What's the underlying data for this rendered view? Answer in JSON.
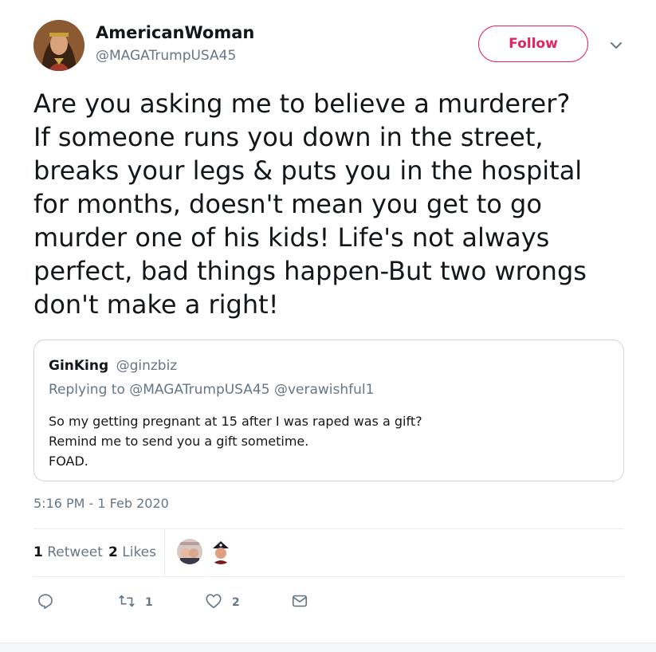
{
  "author": {
    "display_name": "AmericanWoman",
    "handle": "@MAGATrumpUSA45"
  },
  "follow_label": "Follow",
  "tweet_lines": [
    "Are you asking me to believe a murderer?",
    "If someone runs you down in the street,",
    "breaks your legs & puts you in the hospital",
    "for months, doesn't mean you get to go",
    "murder one of his kids! Life's not always",
    "perfect, bad things happen-But two wrongs",
    "don't make a right!"
  ],
  "quoted": {
    "name": "GinKing",
    "handle": "@ginzbiz",
    "replying_prefix": "Replying to",
    "replying_to_1": "@MAGATrumpUSA45",
    "replying_to_2": "@verawishful1",
    "lines": [
      "So my getting pregnant at 15 after I was raped was a gift?",
      "Remind me to send you a gift sometime.",
      "FOAD."
    ]
  },
  "timestamp": "5:16 PM - 1 Feb 2020",
  "stats": {
    "retweet_count": "1",
    "retweet_label": "Retweet",
    "like_count": "2",
    "like_label": "Likes"
  },
  "actions": {
    "reply_icon": "reply-icon",
    "retweet_icon": "retweet-icon",
    "retweet_count": "1",
    "like_icon": "heart-icon",
    "like_count": "2",
    "dm_icon": "envelope-icon"
  },
  "colors": {
    "follow_accent": "#e0245e",
    "secondary_text": "#657786",
    "primary_text": "#14171a",
    "border": "#e6ecf0"
  }
}
